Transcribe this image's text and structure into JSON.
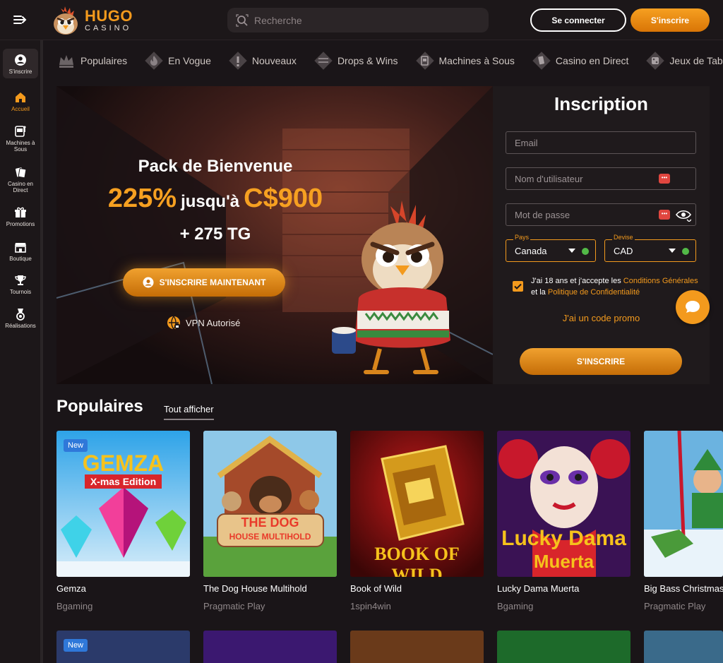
{
  "header": {
    "logo_name": "HUGO",
    "logo_sub": "CASINO",
    "search_placeholder": "Recherche",
    "login_label": "Se connecter",
    "signup_label": "S'inscrire"
  },
  "sidebar": {
    "items": [
      {
        "label": "S'inscrire",
        "icon": "user-icon"
      },
      {
        "label": "Accueil",
        "icon": "home-icon"
      },
      {
        "label": "Machines à Sous",
        "icon": "slot-machine-icon"
      },
      {
        "label": "Casino en Direct",
        "icon": "cards-icon"
      },
      {
        "label": "Promotions",
        "icon": "gift-icon"
      },
      {
        "label": "Boutique",
        "icon": "shop-icon"
      },
      {
        "label": "Tournois",
        "icon": "trophy-icon"
      },
      {
        "label": "Réalisations",
        "icon": "medal-icon"
      }
    ]
  },
  "categories": [
    {
      "label": "Populaires",
      "icon": "crown-icon"
    },
    {
      "label": "En Vogue",
      "icon": "fire-icon"
    },
    {
      "label": "Nouveaux",
      "icon": "exclamation-icon"
    },
    {
      "label": "Drops & Wins",
      "icon": "drops-wins-icon"
    },
    {
      "label": "Machines à Sous",
      "icon": "slot-machine-icon"
    },
    {
      "label": "Casino en Direct",
      "icon": "cards-icon"
    },
    {
      "label": "Jeux de Table",
      "icon": "dice-icon"
    }
  ],
  "hero": {
    "title": "Pack de Bienvenue",
    "percent": "225%",
    "upto": "jusqu'à",
    "amount": "C$900",
    "extra": "+ 275 TG",
    "cta": "S'INSCRIRE MAINTENANT",
    "vpn": "VPN Autorisé"
  },
  "registration": {
    "title": "Inscription",
    "email_placeholder": "Email",
    "username_placeholder": "Nom d'utilisateur",
    "password_placeholder": "Mot de passe",
    "country_label": "Pays",
    "country_value": "Canada",
    "currency_label": "Devise",
    "currency_value": "CAD",
    "terms_prefix": "J'ai 18 ans et j'accepte les ",
    "terms_link": "Conditions Générales",
    "terms_mid": " et la ",
    "privacy_link": "Politique de Confidentialité",
    "promo": "J'ai un code promo",
    "submit": "S'INSCRIRE"
  },
  "popular": {
    "title": "Populaires",
    "see_all": "Tout afficher",
    "badge_new": "New",
    "games": [
      {
        "name": "Gemza",
        "provider": "Bgaming",
        "new": true,
        "art_text": "GEMZA",
        "art_sub": "X-mas Edition"
      },
      {
        "name": "The Dog House Multihold",
        "provider": "Pragmatic Play",
        "new": false,
        "art_text": "THE DOG",
        "art_sub": "HOUSE MULTIHOLD"
      },
      {
        "name": "Book of Wild",
        "provider": "1spin4win",
        "new": false,
        "art_text": "BOOK OF WILD",
        "art_sub": ""
      },
      {
        "name": "Lucky Dama Muerta",
        "provider": "Bgaming",
        "new": false,
        "art_text": "Lucky Dama",
        "art_sub": "Muerta"
      },
      {
        "name": "Big Bass Christmas",
        "provider": "Pragmatic Play",
        "new": false,
        "art_text": "",
        "art_sub": ""
      }
    ]
  },
  "colors": {
    "accent": "#f39a1d",
    "background": "#1a1518",
    "panel": "#1f1a1c",
    "badge_new": "#2f78d9"
  }
}
